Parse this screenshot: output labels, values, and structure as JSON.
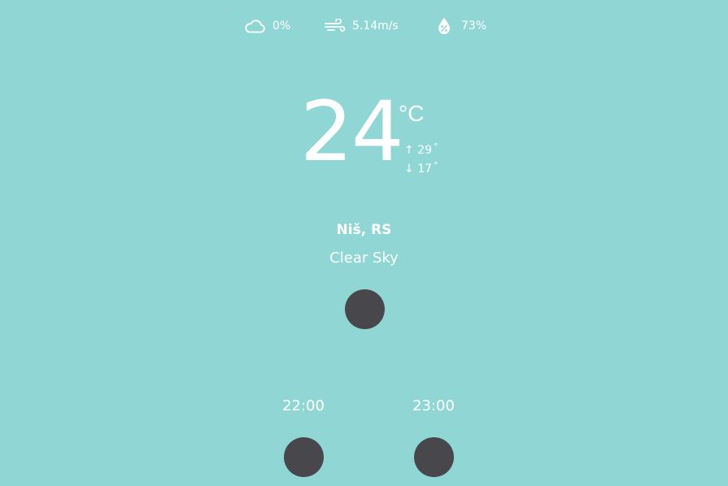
{
  "stats": {
    "cloudiness": "0%",
    "wind": "5.14m/s",
    "humidity": "73%",
    "icons": [
      "cloud-icon",
      "wind-icon",
      "humidity-drop-icon"
    ]
  },
  "current": {
    "temperature": "24",
    "unit": "°C",
    "high": "29",
    "high_arrow": "↑",
    "low": "17",
    "low_arrow": "↓",
    "degree": "°",
    "location": "Niš, RS",
    "description": "Clear Sky",
    "icon": "weather-icon-placeholder"
  },
  "hourly": [
    {
      "time": "22:00",
      "icon": "weather-icon-placeholder"
    },
    {
      "time": "23:00",
      "icon": "weather-icon-placeholder"
    }
  ],
  "colors": {
    "background": "#8fd6d5",
    "text": "#ffffff",
    "icon_placeholder": "#48484c"
  }
}
